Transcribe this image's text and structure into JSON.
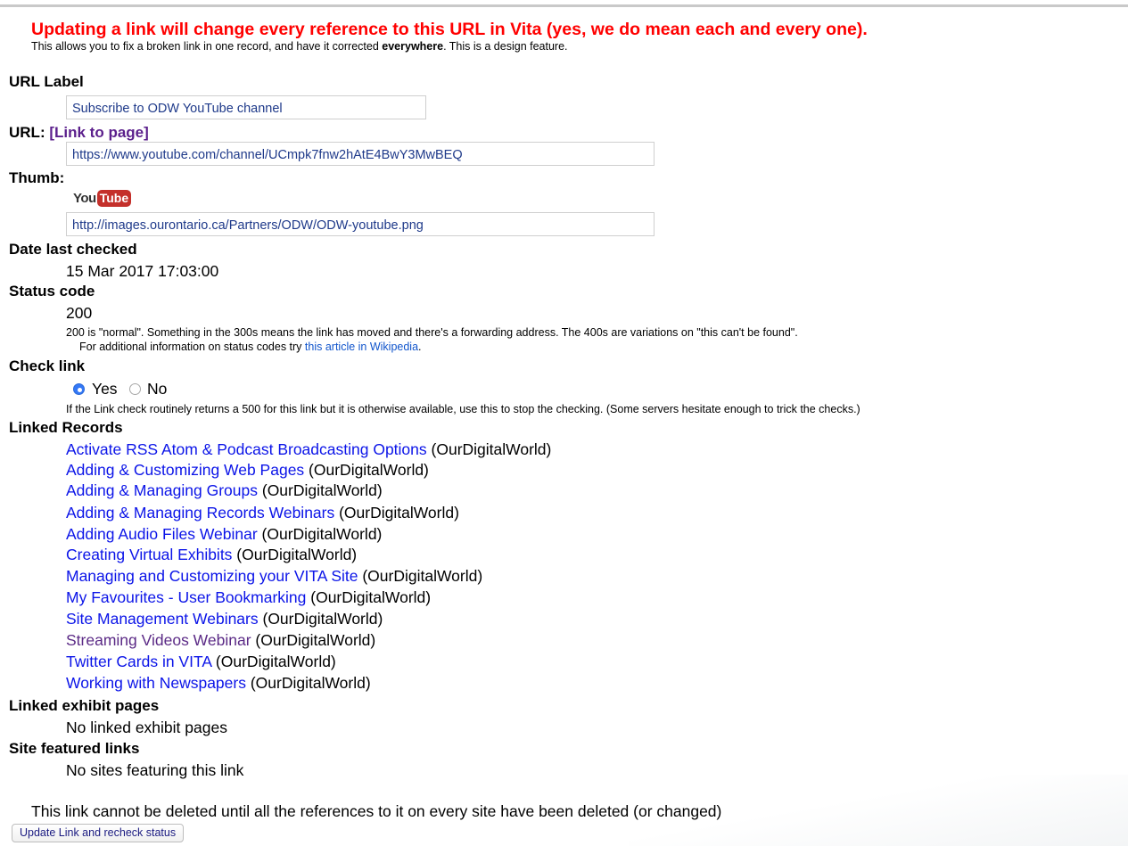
{
  "warning": {
    "headline": "Updating a link will change every reference to this URL in Vita (yes, we do mean each and every one).",
    "sub_before": "This allows you to fix a broken link in one record, and have it corrected ",
    "sub_bold": "everywhere",
    "sub_after": ". This is a design feature."
  },
  "url_label": {
    "label": "URL Label",
    "value": "Subscribe to ODW YouTube channel"
  },
  "url": {
    "label": "URL:",
    "link_text": "[Link to page]",
    "value": "https://www.youtube.com/channel/UCmpk7fnw2hAtE4BwY3MwBEQ"
  },
  "thumb": {
    "label": "Thumb:",
    "logo_you": "You",
    "logo_tube": "Tube",
    "value": "http://images.ourontario.ca/Partners/ODW/ODW-youtube.png"
  },
  "date_checked": {
    "label": "Date last checked",
    "value": "15 Mar 2017 17:03:00"
  },
  "status": {
    "label": "Status code",
    "value": "200",
    "note": "200 is \"normal\". Something in the 300s means the link has moved and there's a forwarding address. The 400s are variations on \"this can't be found\".",
    "more_prefix": "For additional information on status codes try ",
    "more_link": "this article in Wikipedia",
    "more_suffix": "."
  },
  "check_link": {
    "label": "Check link",
    "yes": "Yes",
    "no": "No",
    "selected": "Yes",
    "note": "If the Link check routinely returns a 500 for this link but it is otherwise available, use this to stop the checking. (Some servers hesitate enough to trick the checks.)"
  },
  "linked_records": {
    "label": "Linked Records",
    "items": [
      {
        "title": "Activate RSS Atom & Podcast Broadcasting Options",
        "site": " (OurDigitalWorld)"
      },
      {
        "title": "Adding & Customizing Web Pages",
        "site": " (OurDigitalWorld)"
      },
      {
        "title": "Adding & Managing Groups",
        "site": " (OurDigitalWorld)"
      },
      {
        "title": "Adding & Managing Records Webinars",
        "site": " (OurDigitalWorld)"
      },
      {
        "title": "Adding Audio Files Webinar",
        "site": " (OurDigitalWorld)"
      },
      {
        "title": "Creating Virtual Exhibits",
        "site": " (OurDigitalWorld)"
      },
      {
        "title": "Managing and Customizing your VITA Site",
        "site": " (OurDigitalWorld)"
      },
      {
        "title": "My Favourites - User Bookmarking",
        "site": " (OurDigitalWorld)"
      },
      {
        "title": "Site Management Webinars",
        "site": " (OurDigitalWorld)"
      },
      {
        "title": "Streaming Videos Webinar",
        "site": " (OurDigitalWorld)"
      },
      {
        "title": "Twitter Cards in VITA",
        "site": " (OurDigitalWorld)"
      },
      {
        "title": "Working with Newspapers",
        "site": " (OurDigitalWorld)"
      }
    ]
  },
  "linked_exhibit_pages": {
    "label": "Linked exhibit pages",
    "value": "No linked exhibit pages"
  },
  "site_featured_links": {
    "label": "Site featured links",
    "value": "No sites featuring this link"
  },
  "delete_note": "This link cannot be deleted until all the references to it on every site have been deleted (or changed)",
  "update_button": "Update Link and recheck status"
}
